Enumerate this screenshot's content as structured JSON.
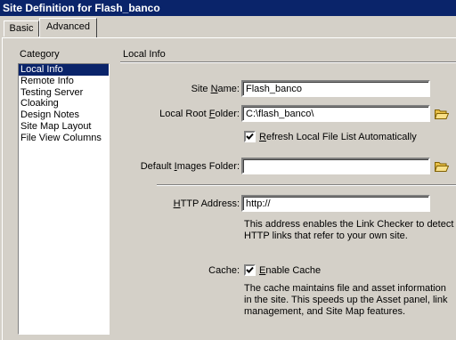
{
  "window": {
    "title": "Site Definition for Flash_banco"
  },
  "tabs": {
    "basic": "Basic",
    "advanced": "Advanced"
  },
  "category": {
    "label": "Category",
    "items": [
      "Local Info",
      "Remote Info",
      "Testing Server",
      "Cloaking",
      "Design Notes",
      "Site Map Layout",
      "File View Columns"
    ],
    "selected": "Local Info"
  },
  "local_info": {
    "section_title": "Local Info",
    "site_name_label_pre": "Site ",
    "site_name_label_u": "N",
    "site_name_label_post": "ame:",
    "site_name_value": "Flash_banco",
    "root_label_pre": "Local Root ",
    "root_label_u": "F",
    "root_label_post": "older:",
    "root_value": "C:\\flash_banco\\",
    "refresh_label_u": "R",
    "refresh_label_post": "efresh Local File List Automatically",
    "refresh_checked": true,
    "images_label_pre": "Default ",
    "images_label_u": "I",
    "images_label_post": "mages Folder:",
    "images_value": "",
    "http_label_u": "H",
    "http_label_post": "TTP Address:",
    "http_value": "http://",
    "http_desc": "This address enables the Link Checker to detect HTTP links that refer to your own site.",
    "cache_label": "Cache:",
    "cache_checkbox_label_u": "E",
    "cache_checkbox_label_post": "nable Cache",
    "cache_checked": true,
    "cache_desc": "The cache maintains file and asset information in the site.  This speeds up the Asset panel, link management, and Site Map features."
  },
  "colors": {
    "title_bar": "#0a246a",
    "face": "#d4d0c8",
    "selection": "#0a246a",
    "folder": "#e8c048"
  }
}
